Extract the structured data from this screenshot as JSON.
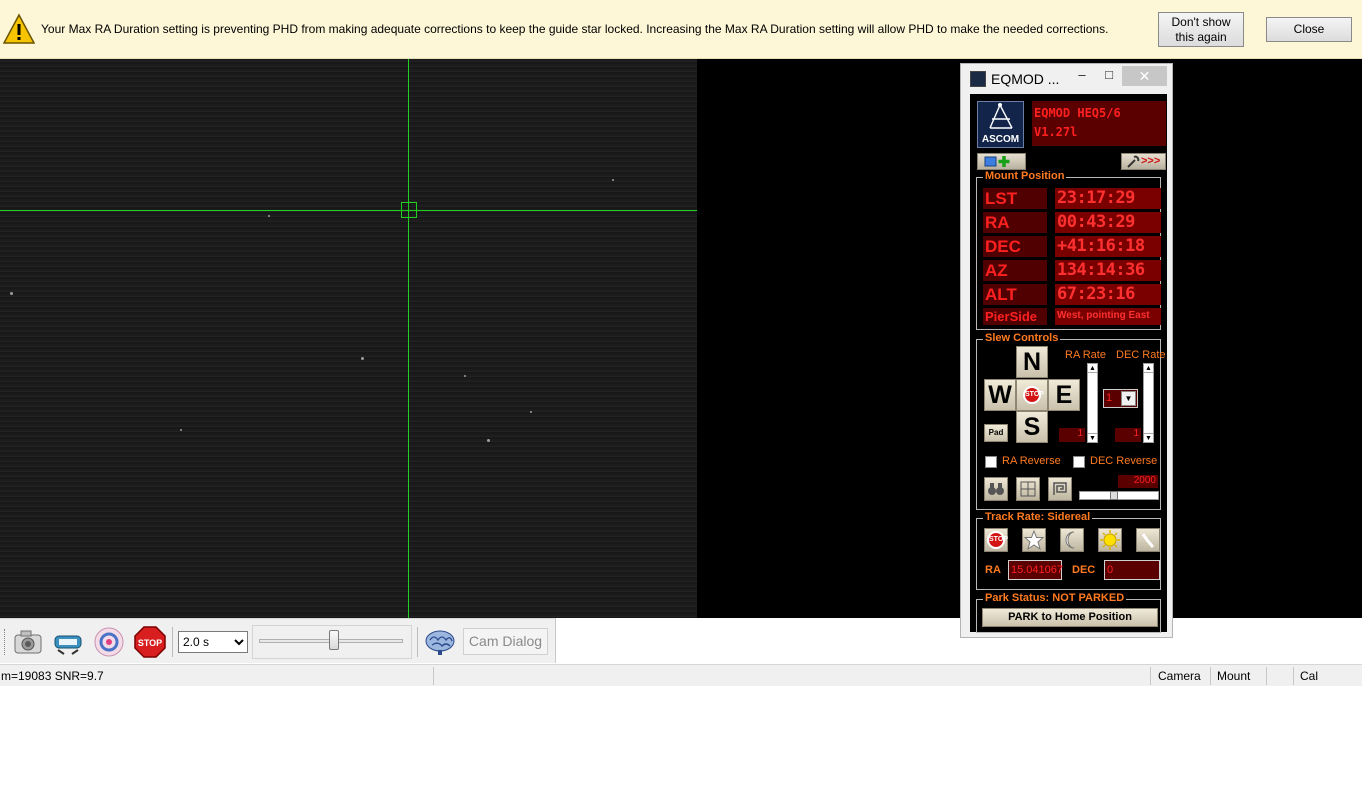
{
  "alert": {
    "message": "Your Max RA Duration setting is preventing PHD from making adequate corrections to keep the guide star locked. Increasing the Max RA Duration setting will allow PHD to make the needed corrections.",
    "dont_show_line1": "Don't show",
    "dont_show_line2": "this again",
    "close_label": "Close",
    "icon": "warning-icon"
  },
  "toolbar": {
    "icons": [
      "camera-icon",
      "telescope-connect-icon",
      "loop-icon",
      "stop-icon",
      "brain-icon"
    ],
    "stop_text": "STOP",
    "exposure": "2.0 s",
    "exposure_options": [
      "2.0 s"
    ],
    "cam_dialog_label": "Cam Dialog"
  },
  "status": {
    "left": "m=19083 SNR=9.7",
    "camera": "Camera",
    "mount": "Mount",
    "cal": "Cal"
  },
  "eqmod": {
    "title": "EQMOD ...",
    "minimize": "–",
    "maximize": "□",
    "close": "✕",
    "ascom_label": "ASCOM",
    "driver_line1": "EQMOD HEQ5/6",
    "driver_line2": "V1.27l",
    "more_label": ">>>",
    "mount_position": {
      "title": "Mount Position",
      "rows": [
        {
          "label": "LST",
          "value": "23:17:29"
        },
        {
          "label": "RA",
          "value": "00:43:29"
        },
        {
          "label": "DEC",
          "value": "+41:16:18"
        },
        {
          "label": "AZ",
          "value": "134:14:36"
        },
        {
          "label": "ALT",
          "value": "67:23:16"
        }
      ],
      "pierside_label": "PierSide",
      "pierside_value": "West, pointing East"
    },
    "slew": {
      "title": "Slew Controls",
      "ra_rate_label": "RA Rate",
      "dec_rate_label": "DEC Rate",
      "north": "N",
      "south": "S",
      "east": "E",
      "west": "W",
      "stop": "STOP",
      "pad": "Pad",
      "ra_rate_value": "1",
      "dec_rate_value": "1",
      "dec_rate_select": "1",
      "ra_reverse": "RA Reverse",
      "dec_reverse": "DEC Reverse",
      "rate_value": "2000"
    },
    "track": {
      "title": "Track Rate: Sidereal",
      "stop": "STOP",
      "ra_label": "RA",
      "ra_value": "15.041067",
      "dec_label": "DEC",
      "dec_value": "0"
    },
    "park": {
      "title": "Park Status: NOT PARKED",
      "button": "PARK to Home Position"
    }
  }
}
